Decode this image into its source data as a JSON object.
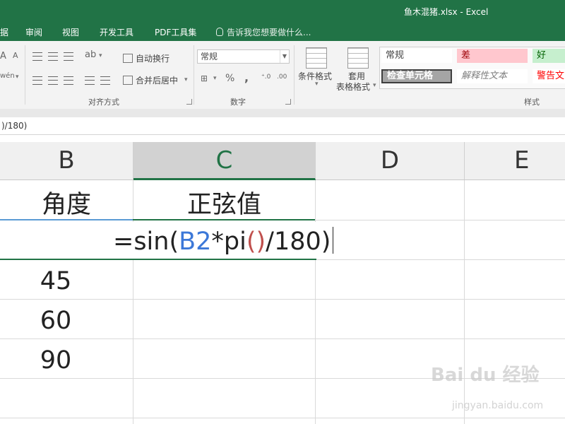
{
  "window": {
    "title": "鱼木混猪.xlsx - Excel"
  },
  "menu": {
    "tabs": [
      "据",
      "审阅",
      "视图",
      "开发工具",
      "PDF工具集"
    ],
    "tellme": "告诉我您想要做什么..."
  },
  "ribbon": {
    "wrap_text": "自动换行",
    "merge_center": "合并后居中",
    "align_group": "对齐方式",
    "number_format": "常规",
    "number_group": "数字",
    "percent": "%",
    "comma": ",",
    "cond_format": "条件格式",
    "table_format_1": "套用",
    "table_format_2": "表格格式",
    "styles_group": "样式",
    "styles": {
      "normal": "常规",
      "bad": "差",
      "good": "好",
      "check_cell": "检查单元格",
      "explanatory": "解释性文本",
      "warning": "警告文"
    }
  },
  "formula_bar": {
    "text": ")/180)"
  },
  "columns": [
    "B",
    "C",
    "D",
    "E"
  ],
  "rows": {
    "header": {
      "b": "角度",
      "c": "正弦值"
    },
    "editing": {
      "prefix": "=sin(",
      "ref": "B2",
      "middle": "*pi",
      "paren": "()",
      "suffix": "/180)"
    },
    "values": [
      "45",
      "60",
      "90"
    ]
  },
  "watermark": {
    "main": "Bai du 经验",
    "sub": "jingyan.baidu.com"
  },
  "colors": {
    "excel_green": "#217346",
    "ref_blue": "#3c78d8",
    "paren_red": "#c0504d"
  }
}
